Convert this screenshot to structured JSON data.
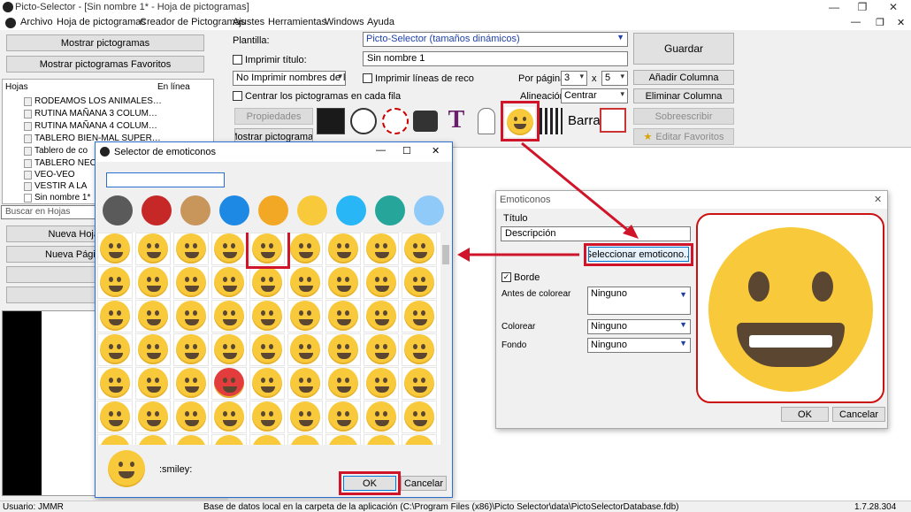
{
  "titlebar": {
    "title": "Picto-Selector - [Sin nombre 1* - Hoja de pictogramas]"
  },
  "menu": [
    "Archivo",
    "Hoja de pictogramas",
    "Creador de Pictogramas",
    "Ajustes",
    "Herramientas",
    "Windows",
    "Ayuda"
  ],
  "left": {
    "show_btn": "Mostrar pictogramas",
    "fav_btn": "Mostrar pictogramas Favoritos",
    "col_hojas": "Hojas",
    "col_linea": "En línea",
    "items": [
      "RODEAMOS LOS ANIMALES…",
      "RUTINA MAÑANA 3 COLUM…",
      "RUTINA MAÑANA 4 COLUM…",
      "TABLERO BIEN-MAL SUPER…",
      "Tablero de co",
      "TABLERO NEC",
      "VEO-VEO",
      "VESTIR A LA",
      "Sin nombre 1*"
    ],
    "search_placeholder": "Buscar en Hojas",
    "nueva_hoja": "Nueva Hoja",
    "nueva_pagina": "Nueva Págin"
  },
  "top": {
    "plantilla_label": "Plantilla:",
    "plantilla_value": "Picto-Selector (tamaños dinámicos)",
    "imprimir_titulo": "Imprimir título:",
    "titulo_value": "Sin nombre 1",
    "no_imprimir": "No Imprimir nombres de lo",
    "imprimir_lineas": "Imprimir líneas de reco",
    "por_pagina": "Por página",
    "cols": "3",
    "x": "x",
    "rows": "5",
    "centrar": "Centrar los pictogramas en cada fila",
    "alineacion": "Alineación",
    "alineacion_value": "Centrar",
    "propiedades": "Propiedades",
    "mostrar": "Mostrar pictogramas",
    "barra": "Barra",
    "guardar": "Guardar",
    "anadir_col": "Añadir Columna",
    "eliminar_col": "Eliminar Columna",
    "sobreescribir": "Sobreescribir",
    "editar_fav": "Editar Favoritos"
  },
  "selector": {
    "title": ":Selector de emoticonos",
    "title_text": "Selector de emoticonos",
    "search_value": "",
    "code": ":smiley:",
    "ok": "OK",
    "cancelar": "Cancelar",
    "category_icons": [
      "hammer-pick-icon",
      "netherlands-flag-icon",
      "bread-icon",
      "globe-icon",
      "book-icon",
      "smiley-icon",
      "letter-a-icon",
      "camera-icon",
      "airplane-icon"
    ],
    "rows": 7,
    "cols": 9
  },
  "emoticonos": {
    "title": "Emoticonos",
    "titulo_label": "Título",
    "descripcion": "Descripción",
    "seleccionar": "Seleccionar emoticono...",
    "borde": "Borde",
    "antes_label": "Antes de colorear",
    "antes_value": "Ninguno",
    "colorear_label": "Colorear",
    "colorear_value": "Ninguno",
    "fondo_label": "Fondo",
    "fondo_value": "Ninguno",
    "ok": "OK",
    "cancelar": "Cancelar"
  },
  "status": {
    "user": "Usuario: JMMR",
    "db": "Base de datos local en la carpeta de la aplicación (C:\\Program Files (x86)\\Picto Selector\\data\\PictoSelectorDatabase.fdb)",
    "version": "1.7.28.304"
  },
  "colors": {
    "highlight": "#d0142a",
    "emoji": "#f8c93a",
    "accent": "#1e63c4"
  }
}
